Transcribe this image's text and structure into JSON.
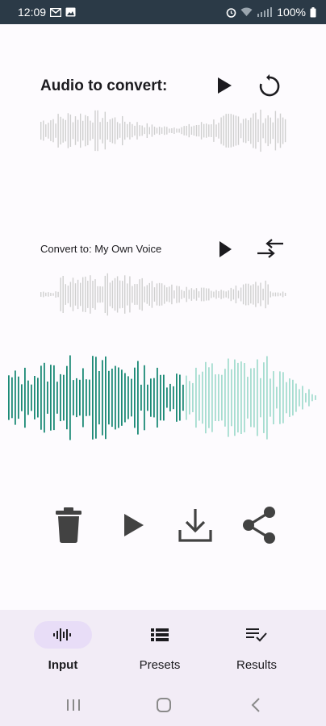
{
  "status_bar": {
    "time": "12:09",
    "battery": "100%"
  },
  "source": {
    "title": "Audio to convert:"
  },
  "target": {
    "title": "Convert to: My Own Voice"
  },
  "colors": {
    "accent": "#1b8a76",
    "accent_light": "#a6ddd0",
    "wave_gray": "#cfcfcf",
    "icon_dark": "#424242"
  },
  "nav": {
    "items": [
      {
        "label": "Input",
        "icon": "waveform-icon",
        "active": true
      },
      {
        "label": "Presets",
        "icon": "list-icon",
        "active": false
      },
      {
        "label": "Results",
        "icon": "checklist-icon",
        "active": false
      }
    ]
  }
}
